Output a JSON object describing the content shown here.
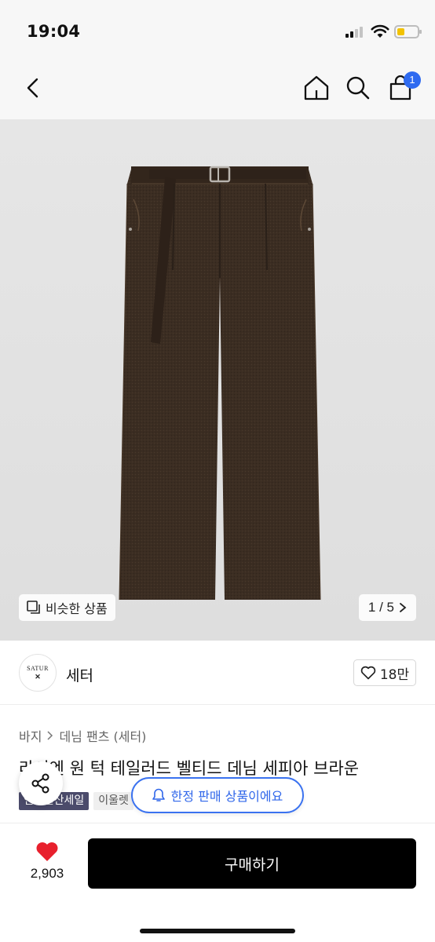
{
  "status": {
    "time": "19:04"
  },
  "nav": {
    "cart_count": "1"
  },
  "gallery": {
    "similar_label": "비슷한 상품",
    "page": "1 / 5",
    "page_position": 1,
    "page_total": 5
  },
  "seller": {
    "logo_text": "SATUR",
    "logo_mark": "✕",
    "name": "세터",
    "likes": "18만"
  },
  "product": {
    "breadcrumb": [
      "바지",
      "데님 팬츠 (세터)"
    ],
    "title": "라이엔 원 턱 테일러드 벨티드 데님 세피아 브라운",
    "tags": [
      "연말결산세일",
      "이울렛"
    ]
  },
  "notice": {
    "label": "한정 판매 상품이에요"
  },
  "bottom": {
    "like_count": "2,903",
    "buy_label": "구매하기"
  },
  "colors": {
    "accent": "#2f6bf0",
    "heart": "#e8202d",
    "buy_button": "#000000",
    "sale_tag": "#4b4b6b"
  }
}
